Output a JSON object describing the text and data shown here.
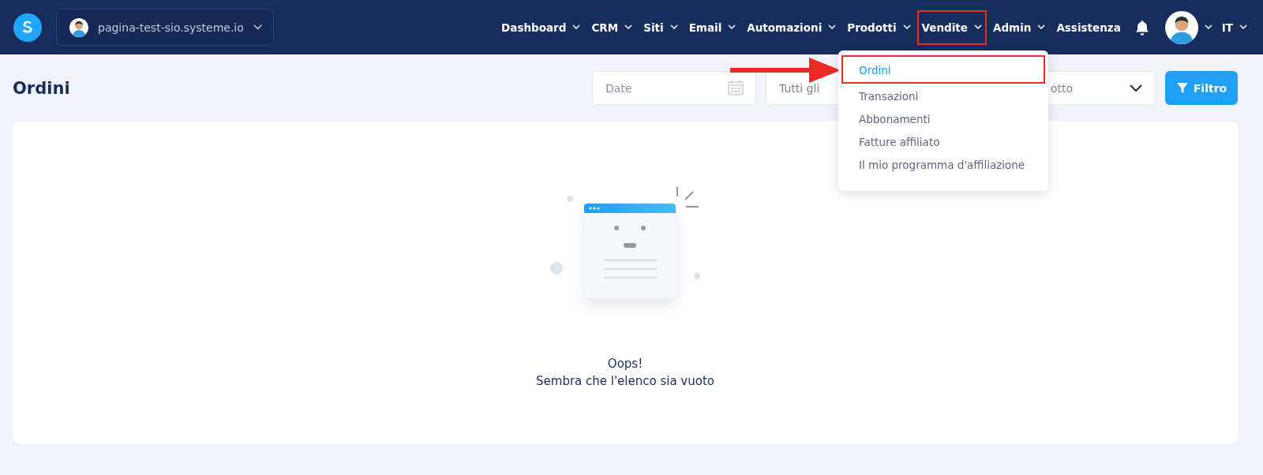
{
  "header": {
    "site_selector": {
      "value": "pagina-test-sio.systeme.io"
    },
    "nav": [
      {
        "label": "Dashboard",
        "has_caret": true,
        "highlighted": false
      },
      {
        "label": "CRM",
        "has_caret": true,
        "highlighted": false
      },
      {
        "label": "Siti",
        "has_caret": true,
        "highlighted": false
      },
      {
        "label": "Email",
        "has_caret": true,
        "highlighted": false
      },
      {
        "label": "Automazioni",
        "has_caret": true,
        "highlighted": false
      },
      {
        "label": "Prodotti",
        "has_caret": true,
        "highlighted": false
      },
      {
        "label": "Vendite",
        "has_caret": true,
        "highlighted": true
      },
      {
        "label": "Admin",
        "has_caret": true,
        "highlighted": false
      },
      {
        "label": "Assistenza",
        "has_caret": false,
        "highlighted": false
      }
    ],
    "language": "IT"
  },
  "page": {
    "title": "Ordini",
    "filters": [
      {
        "kind": "date",
        "placeholder": "Date"
      },
      {
        "kind": "select",
        "value": "Tutti gli"
      },
      {
        "kind": "select",
        "value": "otto"
      }
    ],
    "filter_button": "Filtro"
  },
  "dropdown": {
    "items": [
      {
        "label": "Ordini",
        "selected": true,
        "highlighted": true
      },
      {
        "label": "Transazioni",
        "selected": false,
        "highlighted": false
      },
      {
        "label": "Abbonamenti",
        "selected": false,
        "highlighted": false
      },
      {
        "label": "Fatture affiliato",
        "selected": false,
        "highlighted": false
      },
      {
        "label": "Il mio programma d'affiliazione",
        "selected": false,
        "highlighted": false
      }
    ]
  },
  "empty_state": {
    "title": "Oops!",
    "message": "Sembra che l'elenco sia vuoto"
  }
}
